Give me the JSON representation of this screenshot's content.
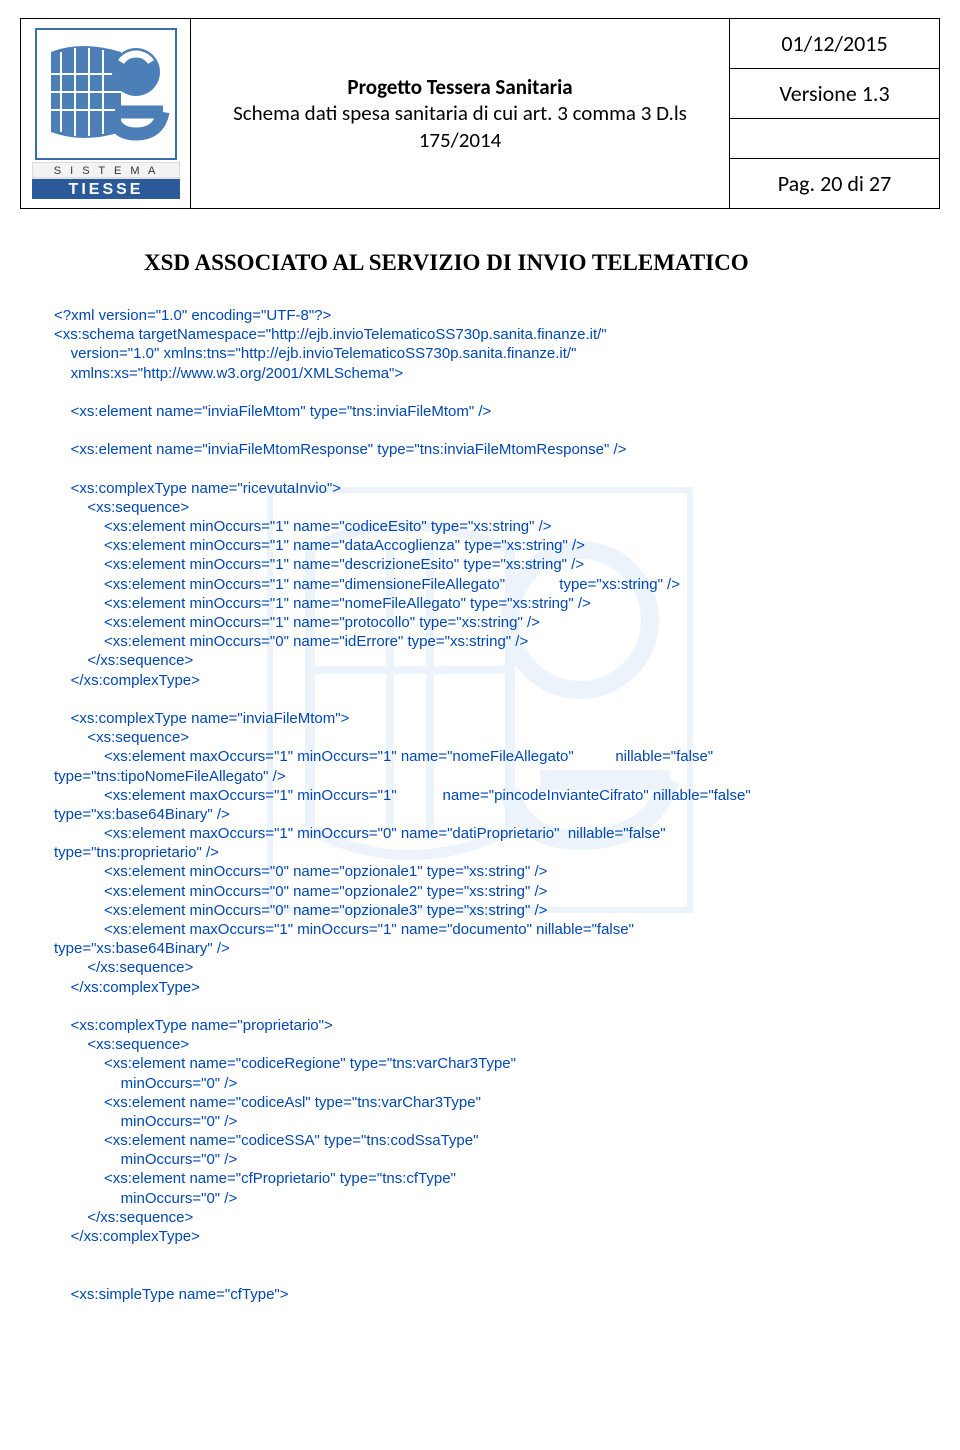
{
  "header": {
    "title_bold": "Progetto Tessera Sanitaria",
    "title_sub": "Schema dati spesa sanitaria di cui art. 3 comma 3 D.ls 175/2014",
    "date": "01/12/2015",
    "version": "Versione 1.3",
    "page": "Pag. 20 di 27",
    "logo_text1": "S I S T E M A",
    "logo_text2": "TIESSE"
  },
  "section": {
    "title": "XSD ASSOCIATO AL SERVIZIO DI INVIO TELEMATICO"
  },
  "xsd": {
    "prolog": "<?xml version=\"1.0\" encoding=\"UTF-8\"?>",
    "schema_open1": "<xs:schema targetNamespace=\"http://ejb.invioTelematicoSS730p.sanita.finanze.it/\"",
    "schema_open2": "    version=\"1.0\" xmlns:tns=\"http://ejb.invioTelematicoSS730p.sanita.finanze.it/\"",
    "schema_open3": "    xmlns:xs=\"http://www.w3.org/2001/XMLSchema\">",
    "el1": "    <xs:element name=\"inviaFileMtom\" type=\"tns:inviaFileMtom\" />",
    "el2": "    <xs:element name=\"inviaFileMtomResponse\" type=\"tns:inviaFileMtomResponse\" />",
    "ct1_open": "    <xs:complexType name=\"ricevutaInvio\">",
    "seq_open": "        <xs:sequence>",
    "ct1_e1": "            <xs:element minOccurs=\"1\" name=\"codiceEsito\" type=\"xs:string\" />",
    "ct1_e2": "            <xs:element minOccurs=\"1\" name=\"dataAccoglienza\" type=\"xs:string\" />",
    "ct1_e3": "            <xs:element minOccurs=\"1\" name=\"descrizioneEsito\" type=\"xs:string\" />",
    "ct1_e4a": "            <xs:element minOccurs=\"1\" name=\"dimensioneFileAllegato\"",
    "ct1_e4b": "type=\"xs:string\" />",
    "ct1_e5": "            <xs:element minOccurs=\"1\" name=\"nomeFileAllegato\" type=\"xs:string\" />",
    "ct1_e6": "            <xs:element minOccurs=\"1\" name=\"protocollo\" type=\"xs:string\" />",
    "ct1_e7": "            <xs:element minOccurs=\"0\" name=\"idErrore\" type=\"xs:string\" />",
    "seq_close": "        </xs:sequence>",
    "ct_close": "    </xs:complexType>",
    "ct2_open": "    <xs:complexType name=\"inviaFileMtom\">",
    "ct2_e1a": "            <xs:element maxOccurs=\"1\" minOccurs=\"1\" name=\"nomeFileAllegato\"",
    "ct2_e1b": "nillable=\"false\"",
    "ct2_e1c": "type=\"tns:tipoNomeFileAllegato\" />",
    "ct2_e2a": "            <xs:element maxOccurs=\"1\" minOccurs=\"1\"",
    "ct2_e2b": "name=\"pincodeInvianteCifrato\" nillable=\"false\"",
    "ct2_e2c": "type=\"xs:base64Binary\" />",
    "ct2_e3a": "            <xs:element maxOccurs=\"1\" minOccurs=\"0\" name=\"datiProprietario\"",
    "ct2_e3b": "nillable=\"false\"",
    "ct2_e3c": "type=\"tns:proprietario\" />",
    "ct2_e4": "            <xs:element minOccurs=\"0\" name=\"opzionale1\" type=\"xs:string\" />",
    "ct2_e5": "            <xs:element minOccurs=\"0\" name=\"opzionale2\" type=\"xs:string\" />",
    "ct2_e6": "            <xs:element minOccurs=\"0\" name=\"opzionale3\" type=\"xs:string\" />",
    "ct2_e7": "            <xs:element maxOccurs=\"1\" minOccurs=\"1\" name=\"documento\" nillable=\"false\"",
    "ct2_e7b": "type=\"xs:base64Binary\" />",
    "ct3_open": "    <xs:complexType name=\"proprietario\">",
    "ct3_e1a": "            <xs:element name=\"codiceRegione\" type=\"tns:varChar3Type\"",
    "ct3_mo0": "                minOccurs=\"0\" />",
    "ct3_e2a": "            <xs:element name=\"codiceAsl\" type=\"tns:varChar3Type\"",
    "ct3_e3a": "            <xs:element name=\"codiceSSA\" type=\"tns:codSsaType\"",
    "ct3_e4a": "            <xs:element name=\"cfProprietario\" type=\"tns:cfType\"",
    "st1": "    <xs:simpleType name=\"cfType\">"
  }
}
